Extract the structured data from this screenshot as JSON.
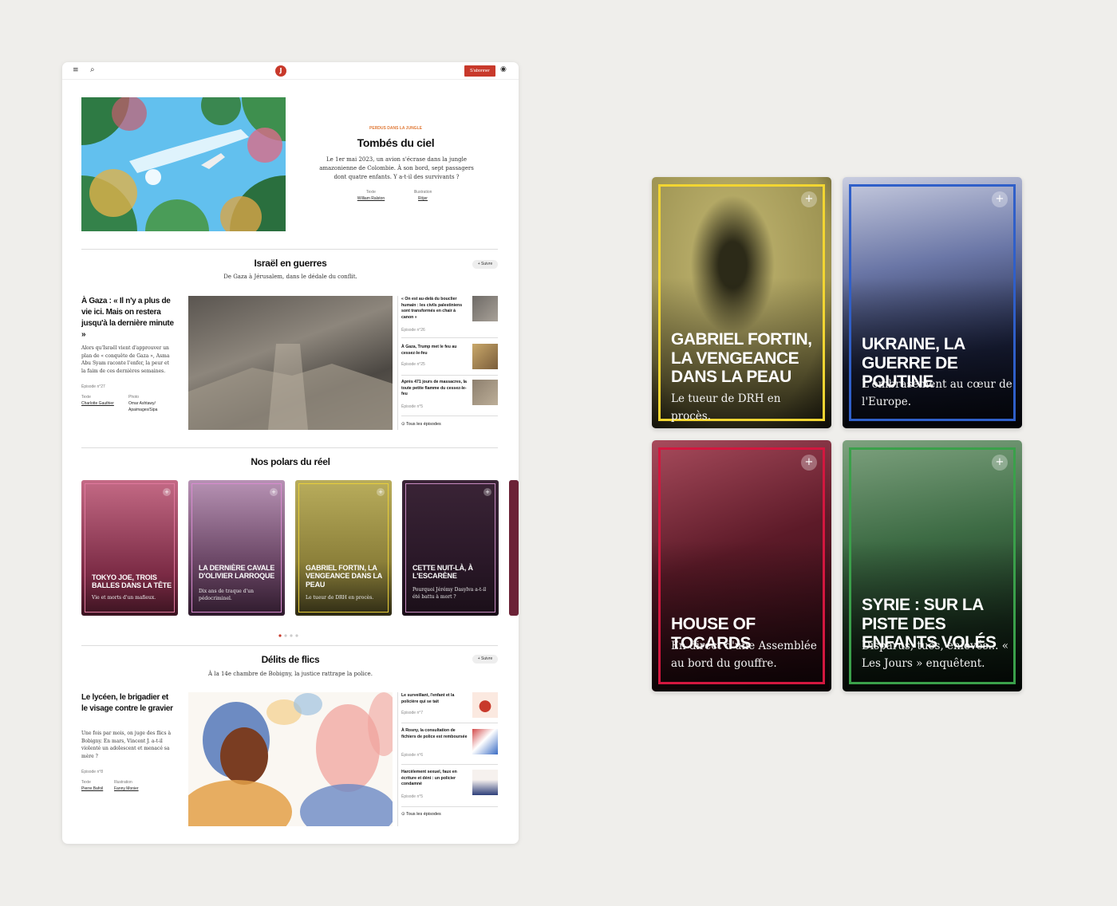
{
  "header": {
    "subscribe_label": "S'abonner",
    "logo_glyph": "J",
    "menu_icon": "menu-icon",
    "search_icon": "search-icon",
    "account_icon": "account-icon"
  },
  "hero": {
    "kicker": "PERDUS DANS LA JUNGLE",
    "title": "Tombés du ciel",
    "lede": "Le 1er mai 2023, un avion s'écrase dans la jungle amazonienne de Colombie. À son bord, sept passagers dont quatre enfants. Y a-t-il des survivants ?",
    "credits": [
      {
        "role": "Texte",
        "name": "William Ralston"
      },
      {
        "role": "Illustration",
        "name": "Röjer"
      }
    ]
  },
  "section1": {
    "title": "Israël en guerres",
    "subtitle": "De Gaza à Jérusalem, dans le dédale du conflit.",
    "follow_label": "+ Suivre",
    "main": {
      "title": "À Gaza : « Il n'y a plus de vie ici. Mais on restera jusqu'à la dernière minute »",
      "body": "Alors qu'Israël vient d'approuver un plan de « conquête de Gaza », Asma Abu Syam raconte l'enfer, la peur et la faim de ces dernières semaines.",
      "episode": "Épisode n°27",
      "credits": [
        {
          "role": "Texte",
          "name": "Charlotte Gauthier"
        },
        {
          "role": "Photo",
          "name": "Omar Ashtawy/ Apaimages/Sipa"
        }
      ]
    },
    "episodes": [
      {
        "title": "« On est au-delà du bouclier humain : les civils palestiniens sont transformés en chair à canon »",
        "episode": "Épisode n°26"
      },
      {
        "title": "À Gaza, Trump met le feu au cessez-le-feu",
        "episode": "Épisode n°25"
      },
      {
        "title": "Après 471 jours de massacres, la toute petite flamme du cessez-le-feu",
        "episode": "Épisode n°5"
      }
    ],
    "all_label": "Tous les épisodes"
  },
  "section2": {
    "title": "Nos polars du réel",
    "cards": [
      {
        "title": "Tokyo Joe, trois balles dans la tête",
        "subtitle": "Vie et morts d'un mafieux.",
        "color": "#e07a9e"
      },
      {
        "title": "La dernière cavale d'Olivier Larroque",
        "subtitle": "Dix ans de traque d'un pédocriminel.",
        "color": "#d98bd0"
      },
      {
        "title": "Gabriel Fortin, la vengeance dans la peau",
        "subtitle": "Le tueur de DRH en procès.",
        "color": "#e9cf3a"
      },
      {
        "title": "Cette nuit-là, à l'Escarène",
        "subtitle": "Pourquoi Jérémy Dasylva a-t-il été battu à mort ?",
        "color": "#c78ac0"
      }
    ]
  },
  "section3": {
    "title": "Délits de flics",
    "subtitle": "À la 14e chambre de Bobigny, la justice rattrape la police.",
    "follow_label": "+ Suivre",
    "main": {
      "title": "Le lycéen, le brigadier et le visage contre le gravier",
      "body": "Une fois par mois, on juge des flics à Bobigny. En mars, Vincent J. a-t-il violenté un adolescent et menacé sa mère ?",
      "episode": "Épisode n°8",
      "credits": [
        {
          "role": "Texte",
          "name": "Pierre Bafoil"
        },
        {
          "role": "Illustration",
          "name": "Fanny Monier"
        }
      ]
    },
    "episodes": [
      {
        "title": "Le surveillant, l'enfant et la policière qui se tait",
        "episode": "Épisode n°7"
      },
      {
        "title": "À Rosny, la consultation de fichiers de police est remboursée",
        "episode": "Épisode n°6"
      },
      {
        "title": "Harcèlement sexuel, faux en écriture et déni : un policier condamné",
        "episode": "Épisode n°5"
      }
    ],
    "all_label": "Tous les épisodes"
  },
  "big_cards": [
    {
      "title": "Gabriel Fortin, la vengeance dans la peau",
      "subtitle": "Le tueur de DRH en procès.",
      "color": "#f2d531"
    },
    {
      "title": "Ukraine, la guerre de Poutine",
      "subtitle": "L'embrasement au cœur de l'Europe.",
      "color": "#2f5fc9"
    },
    {
      "title": "House of tocards",
      "subtitle": "En direct d'une Assemblée au bord du gouffre.",
      "color": "#d3173f"
    },
    {
      "title": "Syrie : sur la piste des enfants volés",
      "subtitle": "Disparus, tués, enlevés... « Les Jours » enquêtent.",
      "color": "#3aa04a"
    }
  ]
}
